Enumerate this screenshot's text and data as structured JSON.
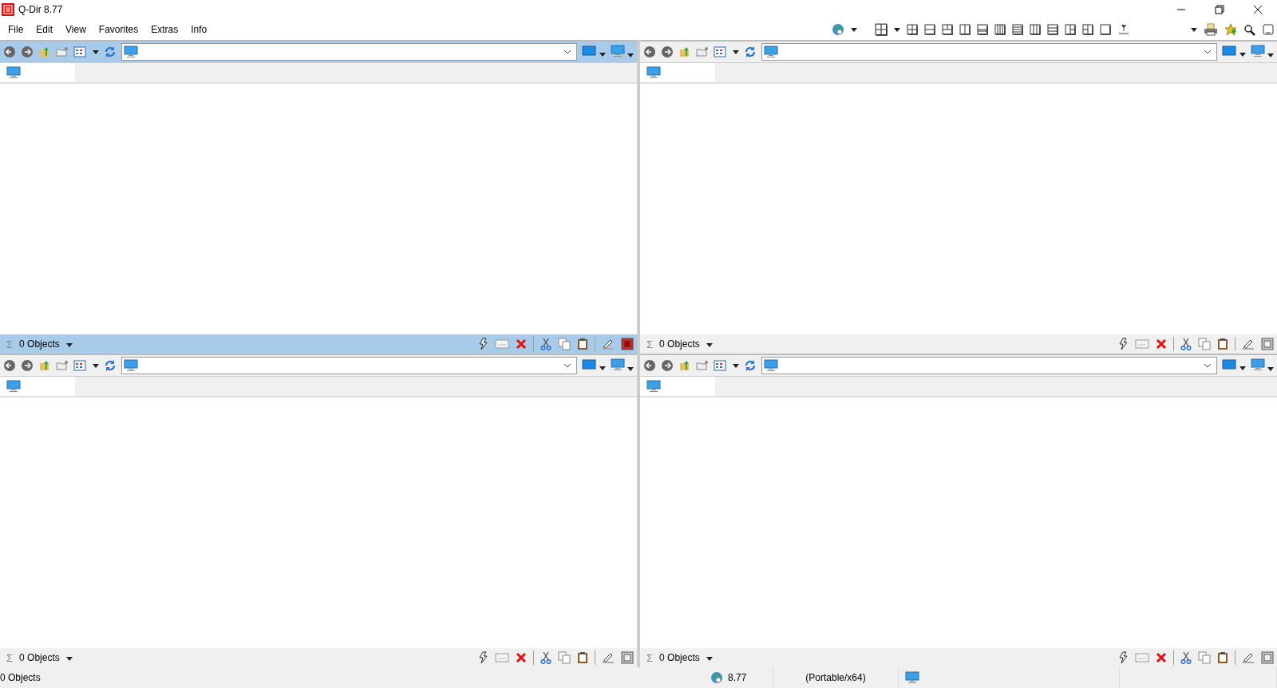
{
  "window": {
    "title": "Q-Dir 8.77"
  },
  "menu": [
    {
      "label": "File"
    },
    {
      "label": "Edit"
    },
    {
      "label": "View"
    },
    {
      "label": "Favorites"
    },
    {
      "label": "Extras"
    },
    {
      "label": "Info"
    }
  ],
  "panes": [
    {
      "active": true,
      "sum_symbol": "Σ",
      "objects": "0 Objects"
    },
    {
      "active": false,
      "sum_symbol": "Σ",
      "objects": "0 Objects"
    },
    {
      "active": false,
      "sum_symbol": "Σ",
      "objects": "0 Objects"
    },
    {
      "active": false,
      "sum_symbol": "Σ",
      "objects": "0 Objects"
    }
  ],
  "status_bar": {
    "objects": "0 Objects",
    "version": "8.77",
    "build": "(Portable/x64)"
  }
}
